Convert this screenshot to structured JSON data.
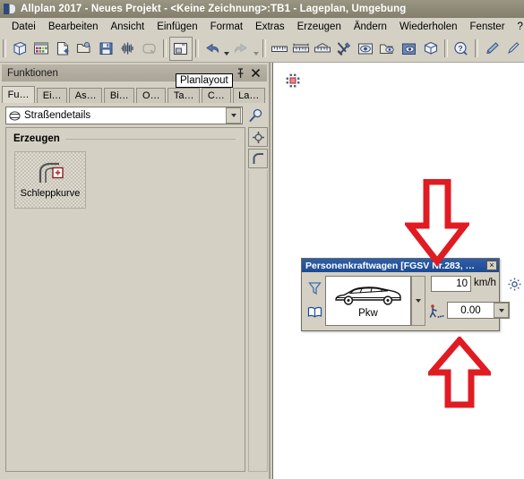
{
  "window": {
    "title": "Allplan 2017 - Neues Projekt - <Keine Zeichnung>:TB1 - Lageplan, Umgebung",
    "logo_icon": "allplan-logo-icon"
  },
  "menu": {
    "items": [
      {
        "label": "Datei"
      },
      {
        "label": "Bearbeiten"
      },
      {
        "label": "Ansicht"
      },
      {
        "label": "Einfügen"
      },
      {
        "label": "Format"
      },
      {
        "label": "Extras"
      },
      {
        "label": "Erzeugen"
      },
      {
        "label": "Ändern"
      },
      {
        "label": "Wiederholen"
      },
      {
        "label": "Fenster"
      },
      {
        "label": "?"
      }
    ]
  },
  "toolbar": {
    "buttons": [
      {
        "icon": "cube-project-icon",
        "name": "project-icon"
      },
      {
        "icon": "layer-palette-icon",
        "name": "layers-icon"
      },
      {
        "icon": "new-document-icon",
        "name": "new-file-icon"
      },
      {
        "icon": "open-folder-icon",
        "name": "open-file-icon"
      },
      {
        "icon": "floppy-save-icon",
        "name": "save-icon"
      },
      {
        "icon": "print-preview-icon",
        "name": "print-icon"
      },
      {
        "icon": "zoom-disabled-icon",
        "name": "zoom-icon"
      },
      {
        "icon": "plan-layout-icon",
        "name": "planlayout-icon"
      },
      {
        "icon": "undo-arrow-icon",
        "name": "undo-icon"
      },
      {
        "icon": "redo-arrow-icon",
        "name": "redo-icon"
      },
      {
        "icon": "ruler-icon",
        "name": "measure-length-icon"
      },
      {
        "icon": "ruler-dim-icon",
        "name": "measure-dimension-icon"
      },
      {
        "icon": "ruler-angle-icon",
        "name": "measure-angle-icon"
      },
      {
        "icon": "tools-icon",
        "name": "tools-icon"
      },
      {
        "icon": "eye-icon",
        "name": "view-icon"
      },
      {
        "icon": "open-view-icon",
        "name": "open-view-icon"
      },
      {
        "icon": "save-view-icon",
        "name": "save-view-icon"
      },
      {
        "icon": "box-3d-icon",
        "name": "model-3d-icon"
      },
      {
        "icon": "help-question-icon",
        "name": "help-icon"
      },
      {
        "icon": "brush-icon",
        "name": "format-brush-icon"
      },
      {
        "icon": "pen-icon",
        "name": "pen-icon"
      }
    ]
  },
  "panel": {
    "title": "Funktionen",
    "pin_icon": "pin-icon",
    "close_icon": "close-icon",
    "tabs": [
      {
        "label": "Fu…"
      },
      {
        "label": "Ei…"
      },
      {
        "label": "As…"
      },
      {
        "label": "Bi…"
      },
      {
        "label": "O…"
      },
      {
        "label": "Ta…"
      },
      {
        "label": "C…"
      },
      {
        "label": "La…"
      }
    ],
    "combo": {
      "value": "Straßendetails",
      "icon": "road-section-icon",
      "dropdown_icon": "chevron-down-icon"
    },
    "search_icon": "search-magnifier-icon",
    "group": {
      "title": "Erzeugen",
      "tools": [
        {
          "label": "Schleppkurve",
          "icon": "swept-path-curve-icon"
        }
      ]
    },
    "side_buttons": [
      {
        "icon": "crosshair-node-icon",
        "name": "node-tool-icon"
      },
      {
        "icon": "curve-corner-icon",
        "name": "curve-tool-icon"
      }
    ]
  },
  "tooltip": {
    "text": "Planlayout"
  },
  "canvas": {
    "marker_icon": "crosshair-target-marker-icon"
  },
  "dialog": {
    "title": "Personenkraftwagen [FGSV Nr.283, …",
    "close_label": "×",
    "filter_icon": "funnel-filter-icon",
    "library_icon": "book-library-icon",
    "vehicle": {
      "label": "Pkw",
      "preview_icon": "car-side-view-icon",
      "dropdown_icon": "chevron-down-icon"
    },
    "speed": {
      "value": "10",
      "unit": "km/h"
    },
    "settings_icon": "gear-settings-icon",
    "steering": {
      "icon": "pedestrian-drag-icon",
      "value": "0.00",
      "dropdown_icon": "chevron-down-icon"
    }
  },
  "annotations": {
    "arrow_down": {
      "name": "red-down-arrow-annotation",
      "color": "#e01b22"
    },
    "arrow_up": {
      "name": "red-up-arrow-annotation",
      "color": "#e01b22"
    }
  },
  "colors": {
    "window_chrome": "#d4d0c4",
    "titlebar": "#8e8a78",
    "dialog_titlebar": "#23509a",
    "annotation_red": "#e01b22"
  }
}
